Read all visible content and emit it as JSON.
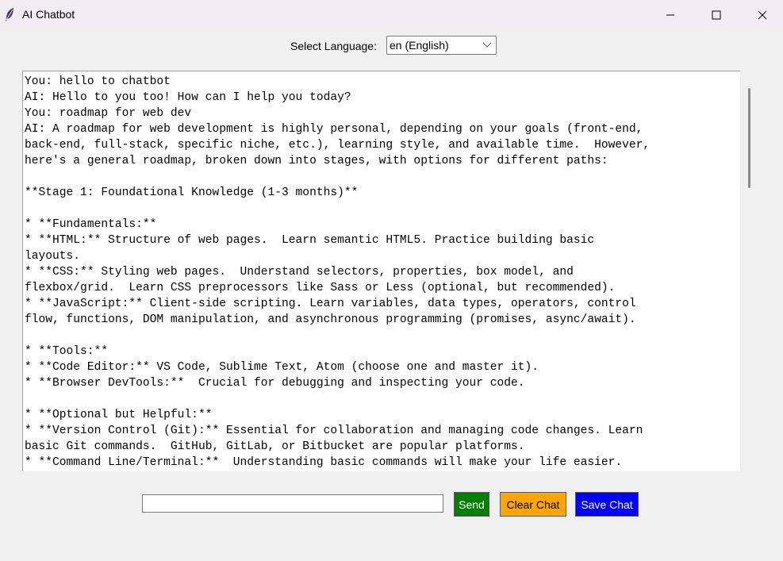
{
  "window": {
    "title": "AI Chatbot",
    "icon": "feather-icon",
    "controls": [
      "minimize-icon",
      "maximize-icon",
      "close-icon"
    ]
  },
  "language": {
    "label": "Select Language:",
    "selected": "en (English)"
  },
  "chat": {
    "lines": [
      "You: hello to chatbot",
      "AI: Hello to you too! How can I help you today?",
      "You: roadmap for web dev",
      "AI: A roadmap for web development is highly personal, depending on your goals (front-end,",
      "back-end, full-stack, specific niche, etc.), learning style, and available time.  However,",
      "here's a general roadmap, broken down into stages, with options for different paths:",
      "",
      "**Stage 1: Foundational Knowledge (1-3 months)**",
      "",
      "* **Fundamentals:**",
      "* **HTML:** Structure of web pages.  Learn semantic HTML5. Practice building basic",
      "layouts.",
      "* **CSS:** Styling web pages.  Understand selectors, properties, box model, and",
      "flexbox/grid.  Learn CSS preprocessors like Sass or Less (optional, but recommended).",
      "* **JavaScript:** Client-side scripting. Learn variables, data types, operators, control",
      "flow, functions, DOM manipulation, and asynchronous programming (promises, async/await).",
      "",
      "* **Tools:**",
      "* **Code Editor:** VS Code, Sublime Text, Atom (choose one and master it).",
      "* **Browser DevTools:**  Crucial for debugging and inspecting your code.",
      "",
      "* **Optional but Helpful:**",
      "* **Version Control (Git):** Essential for collaboration and managing code changes. Learn",
      "basic Git commands.  GitHub, GitLab, or Bitbucket are popular platforms.",
      "* **Command Line/Terminal:**  Understanding basic commands will make your life easier."
    ]
  },
  "input": {
    "value": ""
  },
  "buttons": {
    "send": "Send",
    "clear": "Clear Chat",
    "save": "Save Chat"
  },
  "colors": {
    "send_bg": "#008000",
    "clear_bg": "#ffa500",
    "save_bg": "#0000ff"
  }
}
